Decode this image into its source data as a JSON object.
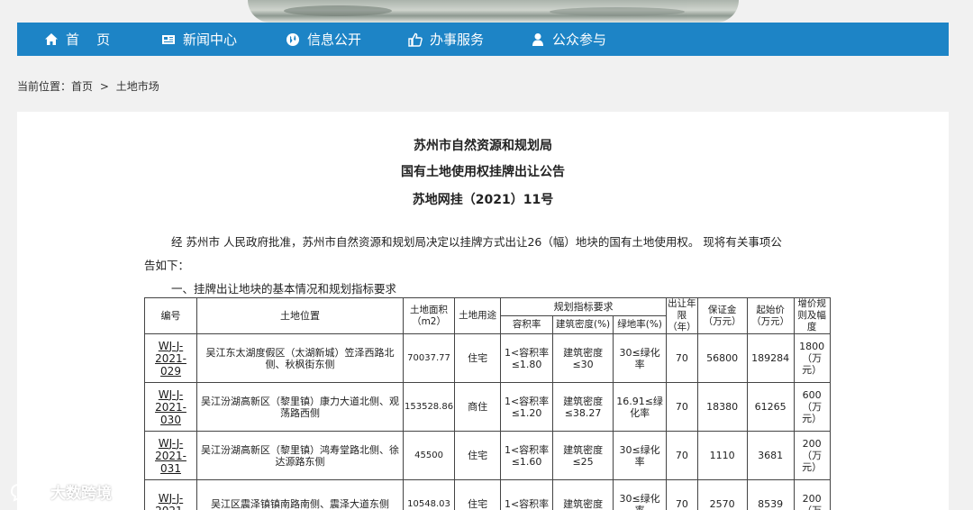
{
  "nav": {
    "items": [
      {
        "label": "首    页",
        "icon": "home-icon"
      },
      {
        "label": "新闻中心",
        "icon": "newspaper-icon"
      },
      {
        "label": "信息公开",
        "icon": "globe-icon"
      },
      {
        "label": "办事服务",
        "icon": "thumbs-up-icon"
      },
      {
        "label": "公众参与",
        "icon": "user-icon"
      }
    ],
    "background": "#1d84c6"
  },
  "breadcrumb": {
    "prefix": "当前位置：",
    "home": "首页",
    "separator": ">",
    "current": "土地市场"
  },
  "notice": {
    "title1": "苏州市自然资源和规划局",
    "title2": "国有土地使用权挂牌出让公告",
    "title3": "苏地网挂（2021）11号",
    "para1": "经 苏州市 人民政府批准，苏州市自然资源和规划局决定以挂牌方式出让26（幅）地块的国有土地使用权。 现将有关事项公",
    "para2": "告如下：",
    "section1": "一、挂牌出让地块的基本情况和规划指标要求"
  },
  "table": {
    "headers": {
      "code": "编号",
      "location": "土地位置",
      "area": "土地面积（m2）",
      "use": "土地用途",
      "planning": "规划指标要求",
      "far": "容积率",
      "density": "建筑密度(%)",
      "green": "绿地率(%)",
      "term": "出让年限（年）",
      "deposit": "保证金（万元）",
      "start": "起始价（万元）",
      "increment": "增价规则及幅度"
    },
    "rows": [
      {
        "code": "WJ-J-2021-029",
        "location": "吴江东太湖度假区（太湖新城）笠泽西路北侧、秋枫街东侧",
        "area": "70037.77",
        "use": "住宅",
        "far": "1<容积率≤1.80",
        "density": "建筑密度≤30",
        "green": "30≤绿化率",
        "term": "70",
        "deposit": "56800",
        "start": "189284",
        "increment": "1800（万元）"
      },
      {
        "code": "WJ-J-2021-030",
        "location": "吴江汾湖高新区（黎里镇）康力大道北侧、观荡路西侧",
        "area": "153528.86",
        "use": "商住",
        "far": "1<容积率≤1.20",
        "density": "建筑密度≤38.27",
        "green": "16.91≤绿化率",
        "term": "70",
        "deposit": "18380",
        "start": "61265",
        "increment": "600（万元）"
      },
      {
        "code": "WJ-J-2021-031",
        "location": "吴江汾湖高新区（黎里镇）鸿寿堂路北侧、徐达源路东侧",
        "area": "45500",
        "use": "住宅",
        "far": "1<容积率≤1.60",
        "density": "建筑密度≤25",
        "green": "30≤绿化率",
        "term": "70",
        "deposit": "1110",
        "start": "3681",
        "increment": "200（万元）"
      },
      {
        "code": "WJ-J-2021-",
        "location": "吴江区震泽镇镇南路南侧、震泽大道东侧",
        "area": "10548.03",
        "use": "住宅",
        "far": "1<容积率",
        "density": "建筑密度",
        "green": "30≤绿化率",
        "term": "70",
        "deposit": "2570",
        "start": "8539",
        "increment": "200（万"
      }
    ]
  },
  "watermark": {
    "text": "大数跨境",
    "icon": "chat-bubbles-icon"
  }
}
